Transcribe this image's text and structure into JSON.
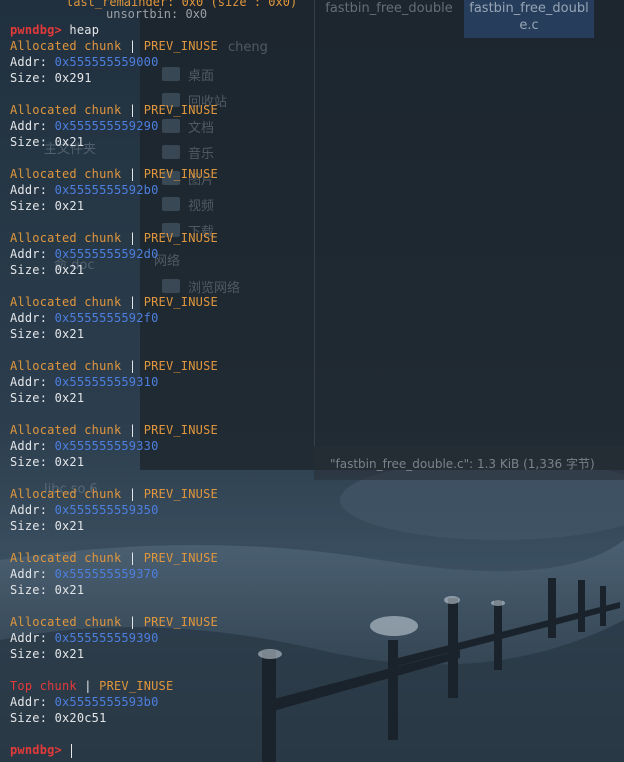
{
  "file_manager": {
    "files": [
      "fastbin_free_double",
      "fastbin_free_double.c"
    ],
    "status_text": "\"fastbin_free_double.c\": 1.3 KiB (1,336 字节)",
    "sidebar": [
      {
        "label": "桌面",
        "icon": "desktop-folder-icon"
      },
      {
        "label": "回收站",
        "icon": "trash-icon"
      },
      {
        "label": "文档",
        "icon": "documents-folder-icon"
      },
      {
        "label": "音乐",
        "icon": "music-folder-icon"
      },
      {
        "label": "图片",
        "icon": "pictures-folder-icon"
      },
      {
        "label": "视频",
        "icon": "videos-folder-icon"
      },
      {
        "label": "下载",
        "icon": "downloads-folder-icon"
      },
      {
        "label": "浏览网络",
        "icon": "network-icon"
      }
    ],
    "background_labels": [
      "主文件夹",
      "网络",
      "cheng",
      "libc.so.6",
      "命 doc"
    ]
  },
  "terminal": {
    "top_partial": "last_remainder: 0x0 (size : 0x0)",
    "top_partial2": "unsortbin: 0x0",
    "prompt": "pwndbg>",
    "command": "heap",
    "addr_label": "Addr:",
    "size_label": "Size:",
    "separator": "|",
    "chunks": [
      {
        "kind": "Allocated chunk",
        "flag": "PREV_INUSE",
        "addr": "0x555555559000",
        "size": "0x291"
      },
      {
        "kind": "Allocated chunk",
        "flag": "PREV_INUSE",
        "addr": "0x555555559290",
        "size": "0x21"
      },
      {
        "kind": "Allocated chunk",
        "flag": "PREV_INUSE",
        "addr": "0x5555555592b0",
        "size": "0x21"
      },
      {
        "kind": "Allocated chunk",
        "flag": "PREV_INUSE",
        "addr": "0x5555555592d0",
        "size": "0x21"
      },
      {
        "kind": "Allocated chunk",
        "flag": "PREV_INUSE",
        "addr": "0x5555555592f0",
        "size": "0x21"
      },
      {
        "kind": "Allocated chunk",
        "flag": "PREV_INUSE",
        "addr": "0x555555559310",
        "size": "0x21"
      },
      {
        "kind": "Allocated chunk",
        "flag": "PREV_INUSE",
        "addr": "0x555555559330",
        "size": "0x21"
      },
      {
        "kind": "Allocated chunk",
        "flag": "PREV_INUSE",
        "addr": "0x555555559350",
        "size": "0x21"
      },
      {
        "kind": "Allocated chunk",
        "flag": "PREV_INUSE",
        "addr": "0x555555559370",
        "size": "0x21"
      },
      {
        "kind": "Allocated chunk",
        "flag": "PREV_INUSE",
        "addr": "0x555555559390",
        "size": "0x21"
      },
      {
        "kind": "Top chunk",
        "flag": "PREV_INUSE",
        "addr": "0x5555555593b0",
        "size": "0x20c51"
      }
    ]
  },
  "colors": {
    "prompt": "#e23a3a",
    "chunk_label": "#e0963c",
    "top_chunk_label": "#e23a3a",
    "address": "#4d7fe0",
    "text": "#e4e6e8"
  }
}
